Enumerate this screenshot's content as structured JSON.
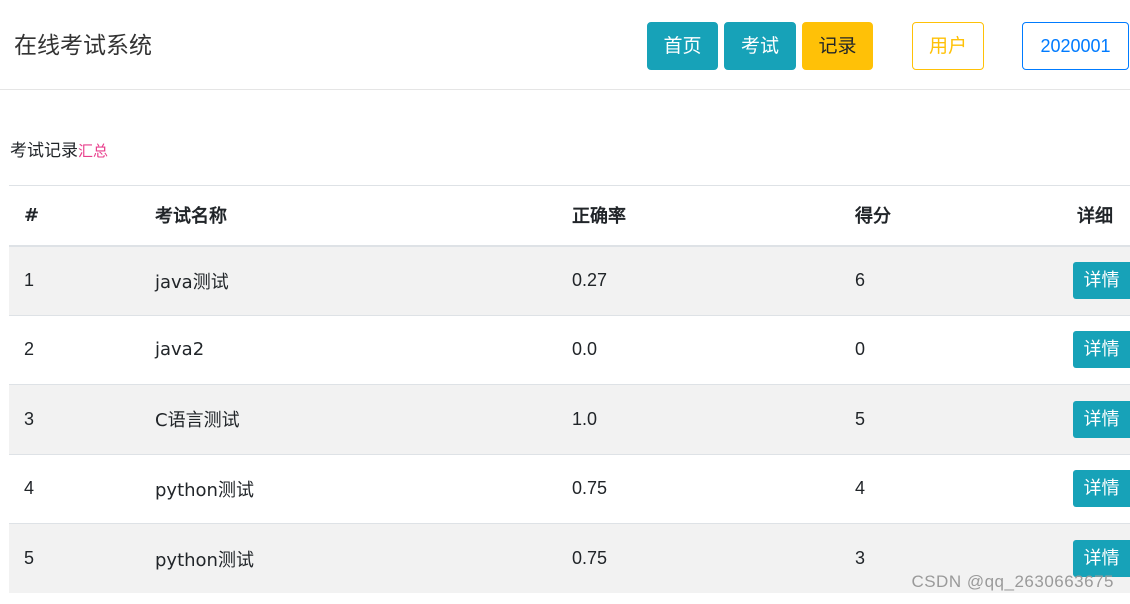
{
  "app": {
    "title": "在线考试系统"
  },
  "nav": {
    "home_label": "首页",
    "exam_label": "考试",
    "records_label": "记录",
    "user_label": "用户",
    "user_id": "2020001"
  },
  "section": {
    "title": "考试记录",
    "subtitle": "汇总"
  },
  "table": {
    "headers": {
      "id": "#",
      "name": "考试名称",
      "rate": "正确率",
      "score": "得分",
      "detail": "详细"
    },
    "rows": [
      {
        "id": "1",
        "name": "java测试",
        "rate": "0.27",
        "score": "6",
        "detail": "详情"
      },
      {
        "id": "2",
        "name": "java2",
        "rate": "0.0",
        "score": "0",
        "detail": "详情"
      },
      {
        "id": "3",
        "name": "C语言测试",
        "rate": "1.0",
        "score": "5",
        "detail": "详情"
      },
      {
        "id": "4",
        "name": "python测试",
        "rate": "0.75",
        "score": "4",
        "detail": "详情"
      },
      {
        "id": "5",
        "name": "python测试",
        "rate": "0.75",
        "score": "3",
        "detail": "详情"
      }
    ]
  },
  "watermark": "CSDN @qq_2630663675",
  "colors": {
    "info": "#17a2b8",
    "warning": "#ffc107",
    "primary": "#007bff",
    "pink": "#e83e8c",
    "stripe": "#f2f2f2"
  }
}
